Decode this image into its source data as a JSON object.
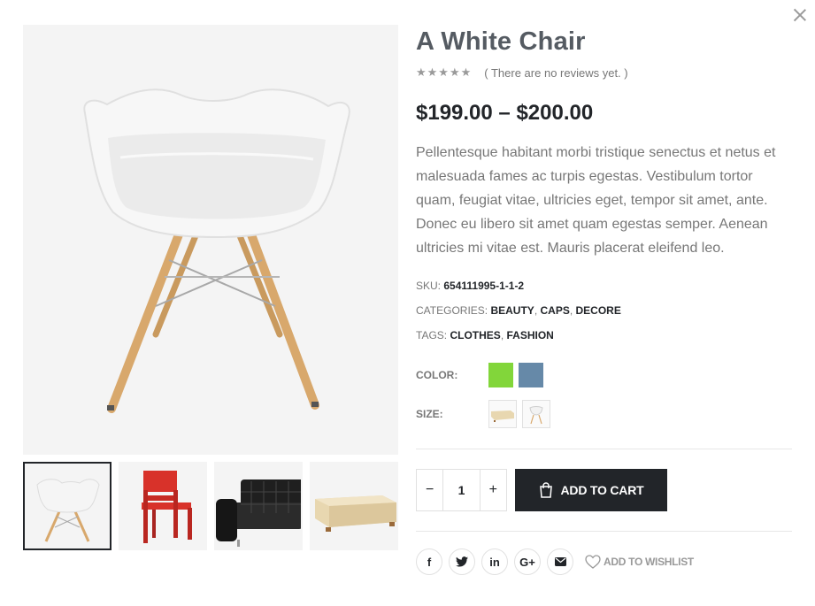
{
  "product": {
    "title": "A White Chair",
    "stars": "★★★★★",
    "reviews": "( There are no reviews yet. )",
    "price": "$199.00 – $200.00",
    "description": "Pellentesque habitant morbi tristique senectus et netus et malesuada fames ac turpis egestas. Vestibulum tortor quam, feugiat vitae, ultricies eget, tempor sit amet, ante. Donec eu libero sit amet quam egestas semper. Aenean ultricies mi vitae est. Mauris placerat eleifend leo.",
    "sku_label": "SKU:",
    "sku": "654111995-1-1-2",
    "categories_label": "CATEGORIES:",
    "categories": [
      "BEAUTY",
      "CAPS",
      "DECORE"
    ],
    "tags_label": "TAGS:",
    "tags": [
      "CLOTHES",
      "FASHION"
    ],
    "color_label": "COLOR:",
    "colors": [
      "#82d63a",
      "#6689a8"
    ],
    "size_label": "SIZE:",
    "sizes": [
      "bench-swatch",
      "chair-swatch"
    ]
  },
  "thumbnails": [
    "white-chair",
    "red-chair",
    "black-leather-sofa",
    "wooden-bench"
  ],
  "cart": {
    "quantity": "1",
    "minus": "−",
    "plus": "+",
    "add_to_cart": "ADD TO CART"
  },
  "share": {
    "facebook": "f",
    "twitter": "twitter-icon",
    "linkedin": "in",
    "googleplus": "G+",
    "email": "email-icon",
    "wishlist": "ADD TO WISHLIST"
  }
}
